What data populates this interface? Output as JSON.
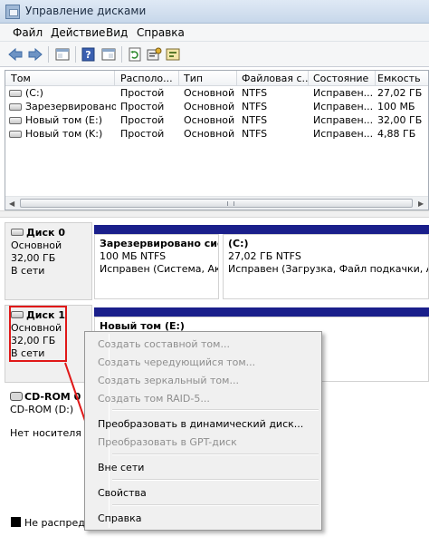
{
  "window": {
    "title": "Управление дисками"
  },
  "menu": [
    "Файл",
    "Действие",
    "Вид",
    "Справка"
  ],
  "toolbar_icons": [
    "back-arrow-icon",
    "forward-arrow-icon",
    "panel-icon",
    "help-icon",
    "panel2-icon",
    "refresh-icon",
    "properties-icon",
    "settings-icon"
  ],
  "volume_list": {
    "columns": [
      "Том",
      "Располо...",
      "Тип",
      "Файловая с...",
      "Состояние",
      "Емкость"
    ],
    "rows": [
      [
        "(C:)",
        "Простой",
        "Основной",
        "NTFS",
        "Исправен...",
        "27,02 ГБ"
      ],
      [
        "Зарезервировано...",
        "Простой",
        "Основной",
        "NTFS",
        "Исправен...",
        "100 МБ"
      ],
      [
        "Новый том (E:)",
        "Простой",
        "Основной",
        "NTFS",
        "Исправен...",
        "32,00 ГБ"
      ],
      [
        "Новый том (K:)",
        "Простой",
        "Основной",
        "NTFS",
        "Исправен...",
        "4,88 ГБ"
      ]
    ]
  },
  "disks": [
    {
      "name": "Диск 0",
      "type": "Основной",
      "size": "32,00 ГБ",
      "status": "В сети",
      "partitions": [
        {
          "name": "Зарезервировано системой",
          "info": "100 МБ NTFS",
          "status": "Исправен (Система, Активен, Основной раздел)"
        },
        {
          "name": "(C:)",
          "info": "27,02 ГБ NTFS",
          "status": "Исправен (Загрузка, Файл подкачки, Аварийный дамп памяти)"
        }
      ]
    },
    {
      "name": "Диск 1",
      "type": "Основной",
      "size": "32,00 ГБ",
      "status": "В сети",
      "partitions": [
        {
          "name": "Новый том (E:)"
        }
      ]
    },
    {
      "name": "CD-ROM 0",
      "type": "CD-ROM (D:)",
      "status": "Нет носителя"
    }
  ],
  "legend": {
    "unallocated": "Не распределено",
    "color": "#000000"
  },
  "context_menu": {
    "items": [
      {
        "label": "Создать составной том...",
        "enabled": false
      },
      {
        "label": "Создать чередующийся том...",
        "enabled": false
      },
      {
        "label": "Создать зеркальный том...",
        "enabled": false
      },
      {
        "label": "Создать том RAID-5...",
        "enabled": false
      },
      {
        "label": "Преобразовать в динамический диск...",
        "enabled": true
      },
      {
        "label": "Преобразовать в GPT-диск",
        "enabled": false
      },
      {
        "label": "Вне сети",
        "enabled": true
      },
      {
        "label": "Свойства",
        "enabled": true
      },
      {
        "label": "Справка",
        "enabled": true
      }
    ]
  },
  "colors": {
    "partition_header": "#1a1f8b",
    "highlight": "#e01818"
  }
}
